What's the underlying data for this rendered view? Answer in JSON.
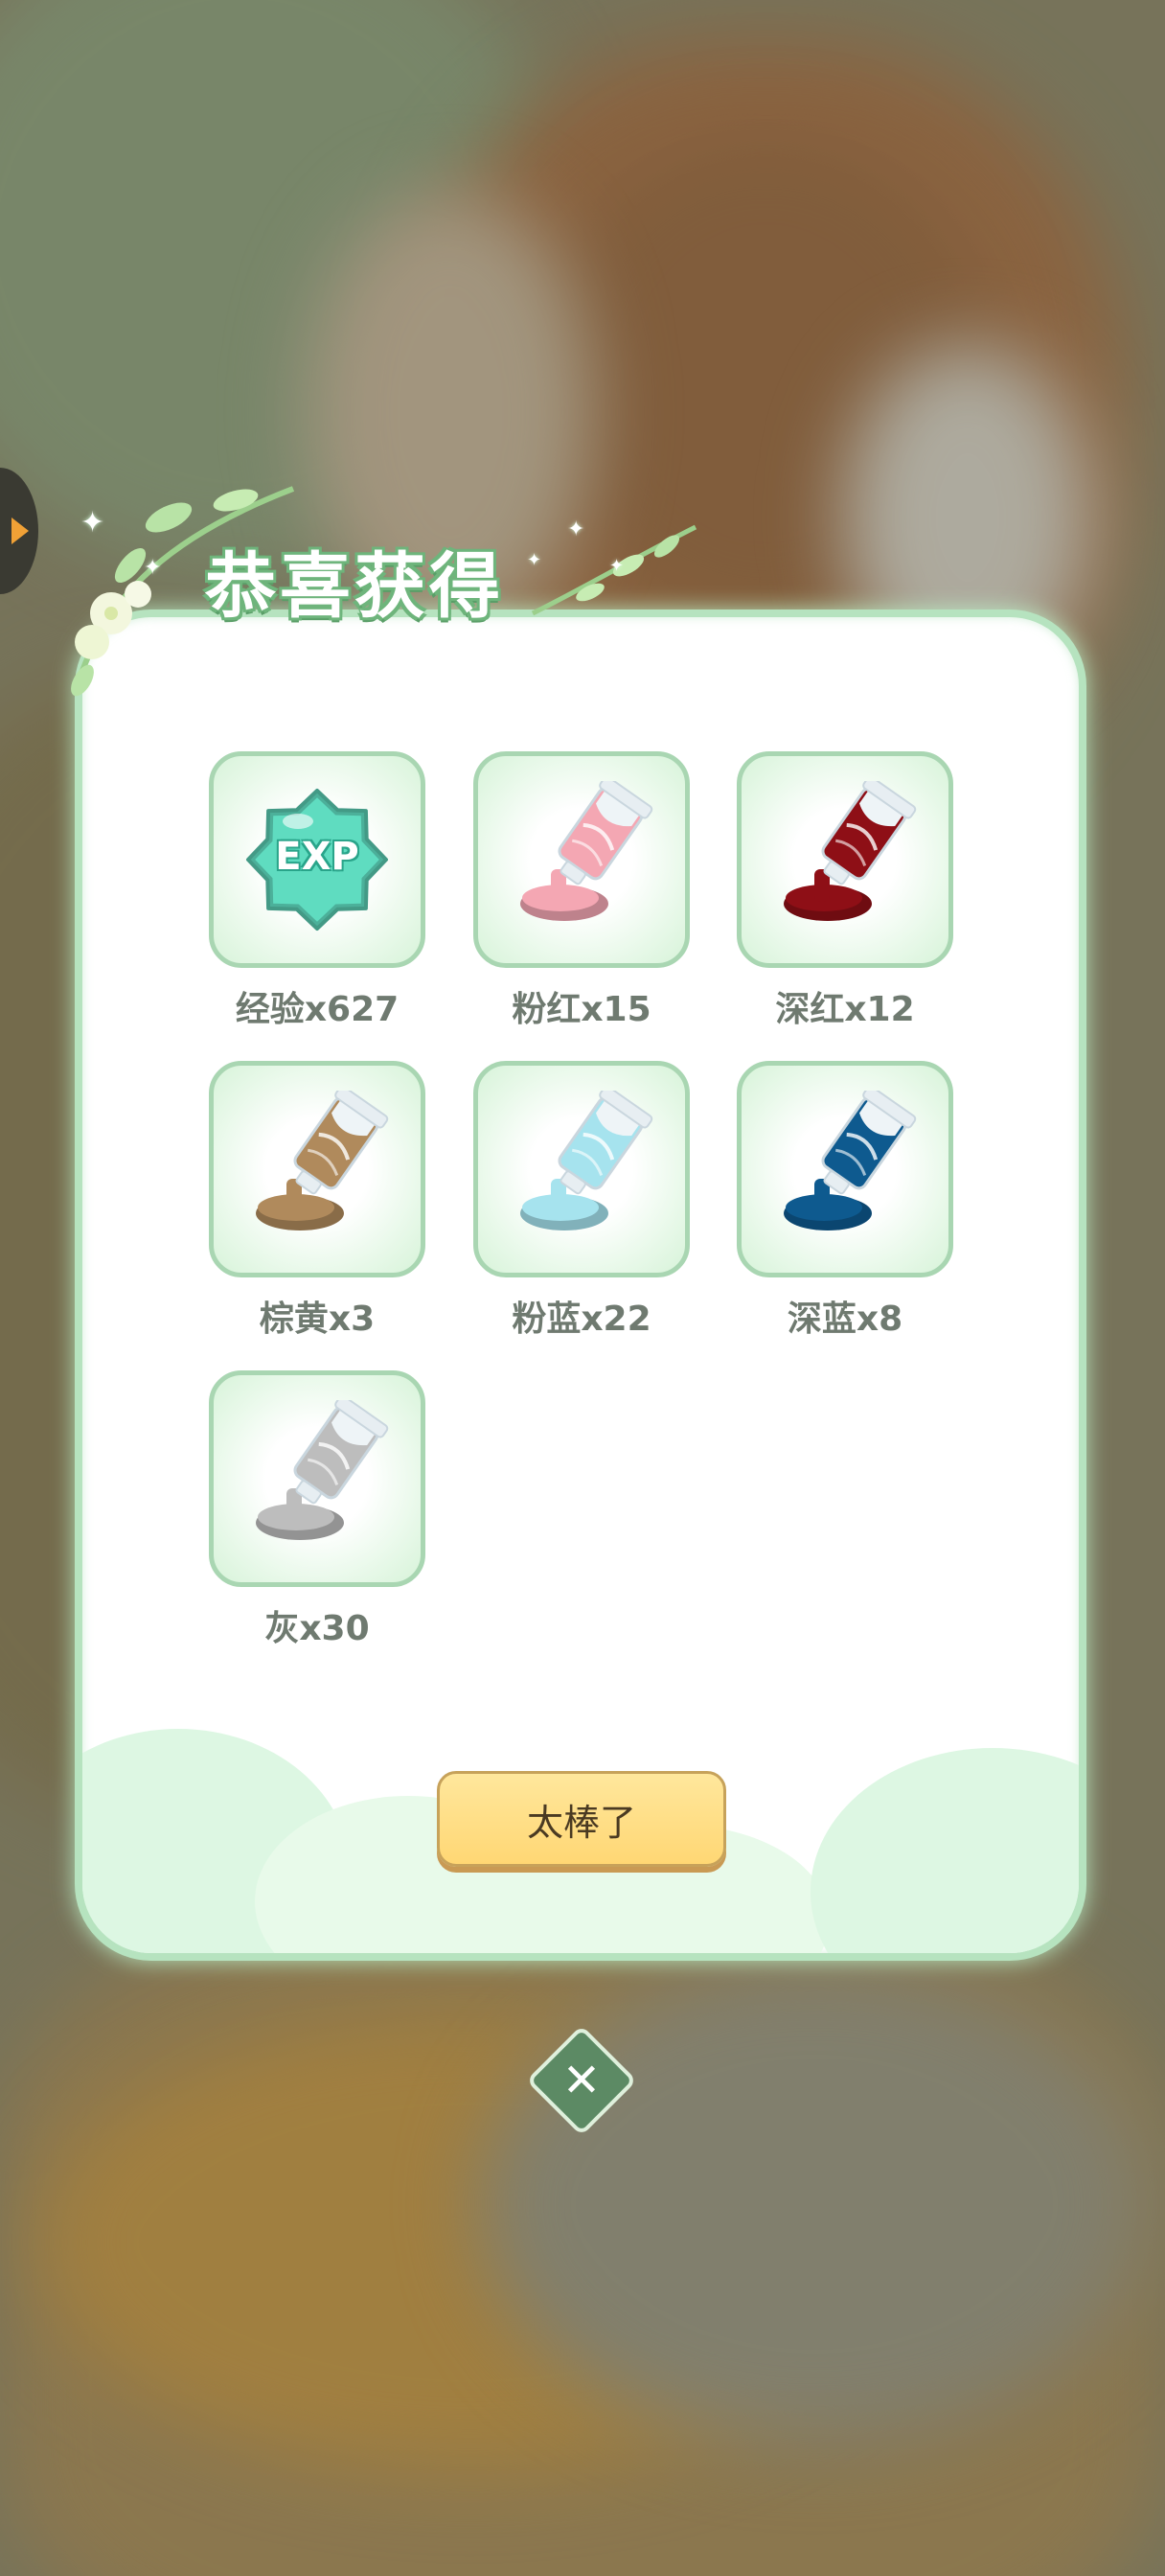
{
  "dialog": {
    "title": "恭喜获得",
    "confirm_label": "太棒了",
    "close_glyph": "✕"
  },
  "rewards": [
    {
      "name": "经验",
      "count": 627,
      "label": "经验x627",
      "icon": "exp-star-icon",
      "color": "#5fdcc0"
    },
    {
      "name": "粉红",
      "count": 15,
      "label": "粉红x15",
      "icon": "paint-tube-icon",
      "color": "#f4a7b3"
    },
    {
      "name": "深红",
      "count": 12,
      "label": "深红x12",
      "icon": "paint-tube-icon",
      "color": "#8e0f16"
    },
    {
      "name": "棕黄",
      "count": 3,
      "label": "棕黄x3",
      "icon": "paint-tube-icon",
      "color": "#b08a5c"
    },
    {
      "name": "粉蓝",
      "count": 22,
      "label": "粉蓝x22",
      "icon": "paint-tube-icon",
      "color": "#a6e3ee"
    },
    {
      "name": "深蓝",
      "count": 8,
      "label": "深蓝x8",
      "icon": "paint-tube-icon",
      "color": "#0e5a8f"
    },
    {
      "name": "灰",
      "count": 30,
      "label": "灰x30",
      "icon": "paint-tube-icon",
      "color": "#bdbdbd"
    }
  ],
  "exp_icon_text": "EXP",
  "colors": {
    "dialog_border": "#b6e3bf",
    "button_fill": "#ffd774",
    "title_outline": "#6fb57c",
    "close_fill": "#5c8a64"
  }
}
